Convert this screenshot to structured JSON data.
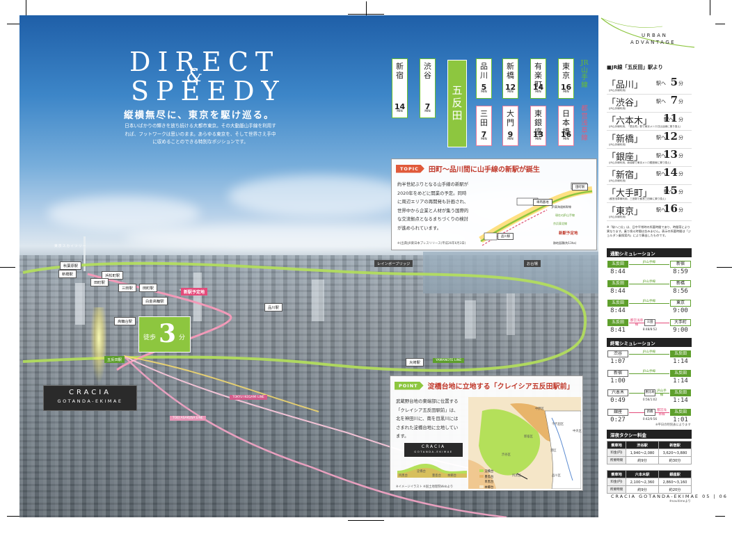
{
  "headline": {
    "line1": "DIRECT",
    "amp": "&",
    "line2": "SPEEDY",
    "sub": "縦横無尽に、東京を駆け巡る。",
    "intro": "日本いばかりの輝きを放ち続ける大都市東京。その大動脈山手線を利用すれば、フットワークは思いのまま。あらゆる東京を、そして世界さえ手中に収めることのできる特別なポジションです。"
  },
  "route_diagram": {
    "hub": "五反田",
    "unit": "MIN",
    "jr_label": "JR山手線",
    "toei_label": "都営浅草線",
    "jr": [
      {
        "name": "新宿",
        "min": "14"
      },
      {
        "name": "渋谷",
        "min": "7"
      },
      {
        "name": "品川",
        "min": "5"
      },
      {
        "name": "新橋",
        "min": "12"
      },
      {
        "name": "有楽町",
        "min": "14"
      },
      {
        "name": "東京",
        "min": "16"
      }
    ],
    "toei": [
      {
        "name": "三田",
        "min": "7"
      },
      {
        "name": "大門",
        "min": "9"
      },
      {
        "name": "東銀座",
        "min": "13"
      },
      {
        "name": "日本橋",
        "min": "16"
      }
    ]
  },
  "topic": {
    "tag": "TOPIC",
    "title": "田町～品川間に山手線の新駅が誕生",
    "body": "約半世紀ぶりとなる山手線の新駅が2020年をめどに開業の予定。同時に周辺エリアの再開発も計画され、世界中から企業と人材が集う国際的な交流拠点となるまちづくりの検討が進められています。",
    "source": "※(出典)JR東日本プレスリリース(平成26年6月3日)",
    "map_labels": {
      "station1": "田町駅",
      "station2": "品川駅",
      "depot": "車両基地",
      "line1": "JR東海道新幹線",
      "line2": "京浜東北線",
      "legend1": "現在のJR山手線",
      "legend2": "新駅予定地",
      "area": "新駅予定地",
      "size": "跡地面積(約13ha)"
    }
  },
  "aerial_labels": {
    "skytree": "東京スカイツリー",
    "akihabara": "秋葉原駅",
    "shinbashi": "新橋駅",
    "hamamatsucho": "浜松町駅",
    "tamachi": "田町駅",
    "mita": "三田駅",
    "shirokane": "白金高輪駅",
    "takanawa": "高輪台駅",
    "shinagawa": "品川駅",
    "new_station": "新駅予定地",
    "rainbow": "レインボーブリッジ",
    "odaiba": "お台場",
    "gotanda": "五反田駅",
    "osaki": "大崎駅",
    "yamanote": "YAMANOTE LINE",
    "ikegami": "TOKYU IKEGAMI LINE",
    "asakusa": "TOEI ASAKUSA LINE"
  },
  "walk": {
    "pre": "徒歩",
    "num": "3",
    "unit": "分"
  },
  "property": {
    "name": "CRACIA",
    "sub": "GOTANDA-EKIMAE"
  },
  "point": {
    "tag": "POINT",
    "title": "淀橋台地に立地する「クレイシア五反田駅前」",
    "body": "武蔵野台地の東端部に位置する「クレイシア五反田駅前」は、北を神田川に、南を目黒川にはさまれた淀橋台地に立地しています。",
    "logo1": "CRACIA",
    "logo2": "GOTANDA-EKIMAE",
    "legend": [
      "淀橋台",
      "豊島台",
      "目黒台",
      "本郷台"
    ],
    "cross": [
      "目黒台",
      "淀橋台",
      "豊島台",
      "本郷台"
    ],
    "map_labels": [
      "中野区",
      "千代田区",
      "中央区",
      "新宿区",
      "渋谷区",
      "港区",
      "品川区",
      "目黒区"
    ],
    "note": "※イメージイラスト ※国土地理院Webより"
  },
  "panel": {
    "ua1": "URBAN",
    "ua2": "ADVANTAGE",
    "jr_head": "■JR線「五反田」駅より",
    "to": "駅へ",
    "unit": "分",
    "times": [
      {
        "st": "「品川」",
        "min": "5",
        "sub": "(JR山手線利用)"
      },
      {
        "st": "「渋谷」",
        "min": "7",
        "sub": "(JR山手線利用)"
      },
      {
        "st": "「六本木」",
        "min": "11",
        "sub": "(JR山手線利用、「恵比寿」駅で東京メトロ日比谷線に乗り換え)"
      },
      {
        "st": "「新橋」",
        "min": "12",
        "sub": "(JR山手線利用)"
      },
      {
        "st": "「銀座」",
        "min": "13",
        "sub": "(JR山手線利用、新橋駅で東京メトロ銀座線に乗り換え)"
      },
      {
        "st": "「新宿」",
        "min": "14",
        "sub": "(JR山手線利用)"
      },
      {
        "st": "「大手町」",
        "min": "15",
        "sub": "(都営浅草線利用、三田駅で都営三田線に乗り換え)"
      },
      {
        "st": "「東京」",
        "min": "16",
        "sub": "(JR山手線利用)"
      }
    ],
    "footnote": "※「駅へ○分」は、日中平常時の所要時間であり、時間帯により異なります。乗り換え時間は含みません。表示の所要時間は「ジョルダン乗換案内」により算出したものです。",
    "commute_head": "通勤シミュレーション",
    "commute": [
      {
        "from": "五反田",
        "t1": "8:44",
        "line": "JR山手線",
        "to": "新宿",
        "t2": "8:59"
      },
      {
        "from": "五反田",
        "t1": "8:44",
        "line": "JR山手線",
        "to": "新橋",
        "t2": "8:56"
      },
      {
        "from": "五反田",
        "t1": "8:44",
        "line": "JR山手線",
        "to": "東京",
        "t2": "9:00"
      },
      {
        "from": "五反田",
        "t1": "8:41",
        "line": "都営浅草線",
        "mid": "三田",
        "mt": "8:48/8:52",
        "to": "大手町",
        "t2": "9:00"
      }
    ],
    "last_head": "終電シミュレーション",
    "last": [
      {
        "from": "渋谷",
        "t1": "1:07",
        "line": "JR山手線",
        "to": "五反田",
        "t2": "1:14"
      },
      {
        "from": "新宿",
        "t1": "1:00",
        "line": "JR山手線",
        "to": "五反田",
        "t2": "1:14"
      },
      {
        "from": "六本木",
        "t1": "0:49",
        "line": "JR山手線",
        "mid": "恵比寿",
        "mt": "0:56/1:02",
        "to": "五反田",
        "t2": "1:14"
      },
      {
        "from": "銀座",
        "t1": "0:27",
        "line": "都営浅草線",
        "mid": "新橋",
        "mt": "0:42/0:56",
        "to": "五反田",
        "t2": "1:01"
      }
    ],
    "last_note": "※平日の時刻表によります",
    "taxi_head": "深夜タクシー料金",
    "taxi": [
      {
        "h": "乗車地",
        "a": "渋谷駅",
        "b": "新宿駅",
        "r1l": "料金(円)",
        "r1a": "1,940～2,080",
        "r1b": "3,620～3,880",
        "r2l": "所要時間",
        "r2a": "約9分",
        "r2b": "約30分"
      },
      {
        "h": "乗車地",
        "a": "六本木駅",
        "b": "銀座駅",
        "r1l": "料金(円)",
        "r1a": "2,100～2,360",
        "r1b": "2,860～3,160",
        "r2l": "所要時間",
        "r2a": "約9分",
        "r2b": "約20分"
      }
    ],
    "taxi_note": "※navitimeより",
    "footer": "CRACIA GOTANDA-EKIMAE 05 | 06"
  }
}
